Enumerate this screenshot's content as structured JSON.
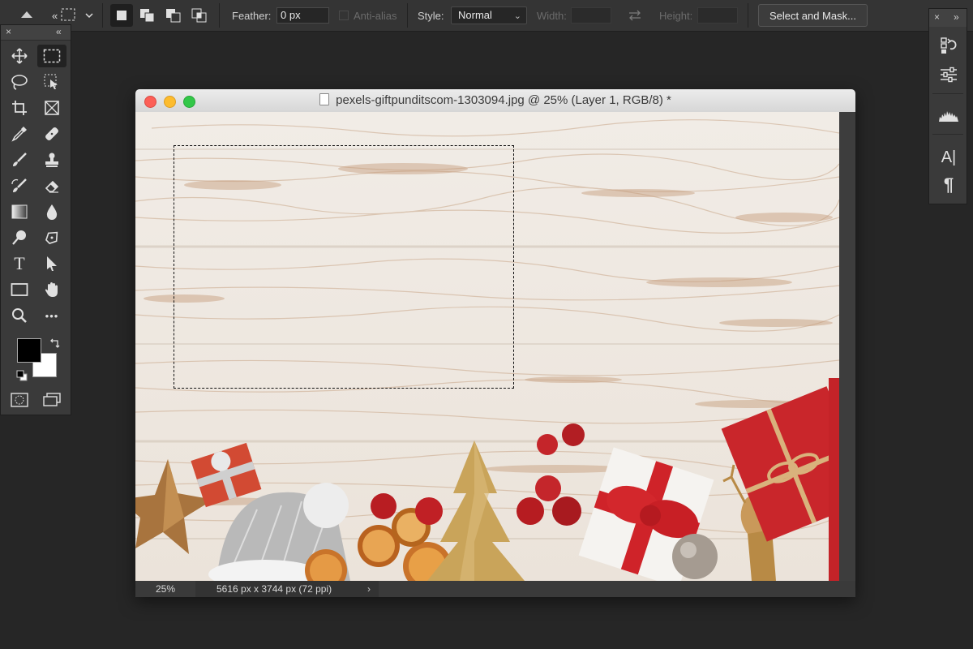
{
  "options_bar": {
    "feather_label": "Feather:",
    "feather_value": "0 px",
    "antialias_label": "Anti-alias",
    "style_label": "Style:",
    "style_value": "Normal",
    "width_label": "Width:",
    "height_label": "Height:",
    "select_mask_label": "Select and Mask..."
  },
  "toolbar": {
    "collapse_glyph": "«",
    "close_glyph": "×",
    "foreground_color": "#000000",
    "background_color": "#ffffff",
    "active_tool": "rectangular-marquee-tool",
    "type_tool_glyph": "T",
    "more_tools_glyph": "•••"
  },
  "right_panel": {
    "close_glyph": "×",
    "expand_glyph": "»",
    "character_glyph": "A|",
    "paragraph_glyph": "¶"
  },
  "document": {
    "title": "pexels-giftpunditscom-1303094.jpg @ 25% (Layer 1, RGB/8) *",
    "zoom": "25%",
    "info": "5616 px x 3744 px (72 ppi)",
    "info_arrow": "›"
  },
  "colors": {
    "traffic_close": "#fc5f57",
    "traffic_minimize": "#fdbc2e",
    "traffic_zoom": "#33c748",
    "gift_red": "#c9262b",
    "ornament_gold": "#c9a45a"
  }
}
